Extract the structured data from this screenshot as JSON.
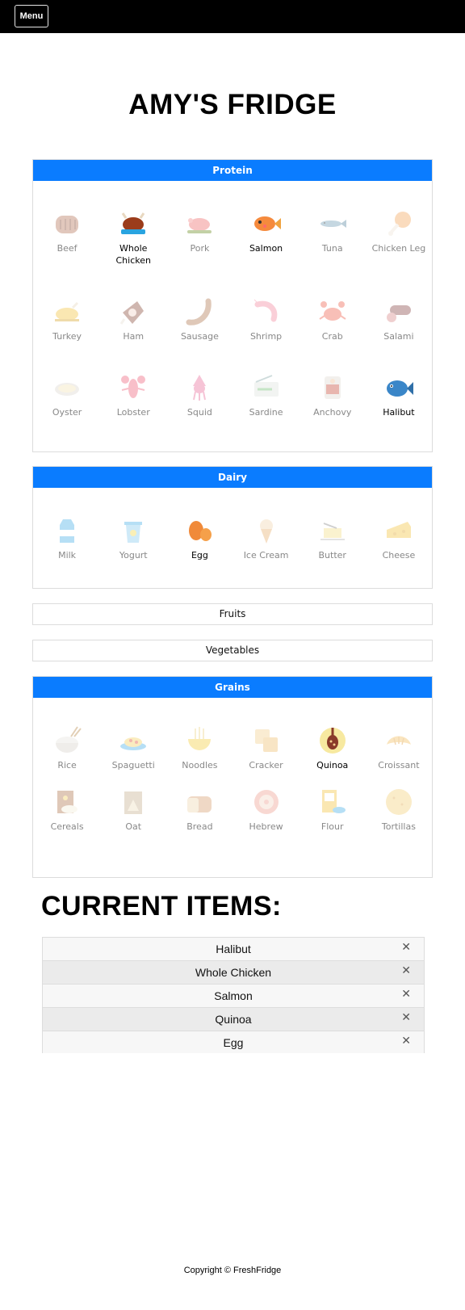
{
  "nav": {
    "menu_label": "Menu"
  },
  "page_title": "AMY'S FRIDGE",
  "categories": [
    {
      "name": "Protein",
      "expanded": true,
      "items": [
        {
          "label": "Beef",
          "icon": "beef-steak-icon",
          "selected": false
        },
        {
          "label": "Whole Chicken",
          "icon": "roast-chicken-icon",
          "selected": true
        },
        {
          "label": "Pork",
          "icon": "roast-pig-icon",
          "selected": false
        },
        {
          "label": "Salmon",
          "icon": "salmon-fish-icon",
          "selected": true
        },
        {
          "label": "Tuna",
          "icon": "tuna-fish-icon",
          "selected": false
        },
        {
          "label": "Chicken Leg",
          "icon": "chicken-leg-icon",
          "selected": false
        },
        {
          "label": "Turkey",
          "icon": "turkey-icon",
          "selected": false
        },
        {
          "label": "Ham",
          "icon": "ham-icon",
          "selected": false
        },
        {
          "label": "Sausage",
          "icon": "sausage-icon",
          "selected": false
        },
        {
          "label": "Shrimp",
          "icon": "shrimp-icon",
          "selected": false
        },
        {
          "label": "Crab",
          "icon": "crab-icon",
          "selected": false
        },
        {
          "label": "Salami",
          "icon": "salami-icon",
          "selected": false
        },
        {
          "label": "Oyster",
          "icon": "oyster-icon",
          "selected": false
        },
        {
          "label": "Lobster",
          "icon": "lobster-icon",
          "selected": false
        },
        {
          "label": "Squid",
          "icon": "squid-icon",
          "selected": false
        },
        {
          "label": "Sardine",
          "icon": "sardine-can-icon",
          "selected": false
        },
        {
          "label": "Anchovy",
          "icon": "anchovy-jar-icon",
          "selected": false
        },
        {
          "label": "Halibut",
          "icon": "halibut-fish-icon",
          "selected": true
        }
      ]
    },
    {
      "name": "Dairy",
      "expanded": true,
      "items": [
        {
          "label": "Milk",
          "icon": "milk-carton-icon",
          "selected": false
        },
        {
          "label": "Yogurt",
          "icon": "yogurt-cup-icon",
          "selected": false
        },
        {
          "label": "Egg",
          "icon": "egg-icon",
          "selected": true
        },
        {
          "label": "Ice Cream",
          "icon": "ice-cream-cone-icon",
          "selected": false
        },
        {
          "label": "Butter",
          "icon": "butter-icon",
          "selected": false
        },
        {
          "label": "Cheese",
          "icon": "cheese-wedge-icon",
          "selected": false
        }
      ]
    },
    {
      "name": "Fruits",
      "expanded": false,
      "items": []
    },
    {
      "name": "Vegetables",
      "expanded": false,
      "items": []
    },
    {
      "name": "Grains",
      "expanded": true,
      "items": [
        {
          "label": "Rice",
          "icon": "rice-bowl-icon",
          "selected": false
        },
        {
          "label": "Spaguetti",
          "icon": "spaghetti-plate-icon",
          "selected": false
        },
        {
          "label": "Noodles",
          "icon": "noodle-bowl-icon",
          "selected": false
        },
        {
          "label": "Cracker",
          "icon": "cracker-icon",
          "selected": false
        },
        {
          "label": "Quinoa",
          "icon": "quinoa-spoon-icon",
          "selected": true
        },
        {
          "label": "Croissant",
          "icon": "croissant-icon",
          "selected": false
        },
        {
          "label": "Cereals",
          "icon": "cereal-box-icon",
          "selected": false
        },
        {
          "label": "Oat",
          "icon": "oat-bag-icon",
          "selected": false
        },
        {
          "label": "Bread",
          "icon": "bread-loaf-icon",
          "selected": false
        },
        {
          "label": "Hebrew",
          "icon": "flower-cookie-icon",
          "selected": false
        },
        {
          "label": "Flour",
          "icon": "flour-bag-icon",
          "selected": false
        },
        {
          "label": "Tortillas",
          "icon": "tortilla-icon",
          "selected": false
        }
      ]
    }
  ],
  "current_items_title": "CURRENT ITEMS:",
  "current_items": [
    "Halibut",
    "Whole Chicken",
    "Salmon",
    "Quinoa",
    "Egg"
  ],
  "remove_symbol": "✕",
  "footer": "Copyright © FreshFridge",
  "colors": {
    "accent": "#0a7cff",
    "topbar": "#000000"
  }
}
